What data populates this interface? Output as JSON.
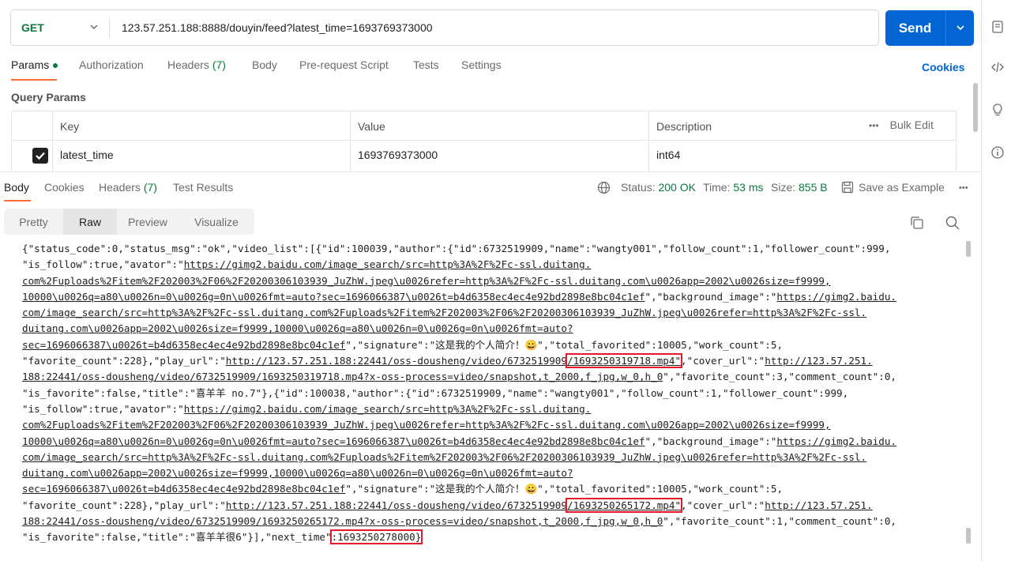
{
  "request": {
    "method": "GET",
    "url": "123.57.251.188:8888/douyin/feed?latest_time=1693769373000",
    "send_label": "Send"
  },
  "request_tabs": [
    {
      "label": "Params",
      "count": ""
    },
    {
      "label": "Authorization",
      "count": ""
    },
    {
      "label": "Headers",
      "count": "(7)"
    },
    {
      "label": "Body",
      "count": ""
    },
    {
      "label": "Pre-request Script",
      "count": ""
    },
    {
      "label": "Tests",
      "count": ""
    },
    {
      "label": "Settings",
      "count": ""
    }
  ],
  "cookies_link": "Cookies",
  "query_params": {
    "title": "Query Params",
    "headers": {
      "key": "Key",
      "value": "Value",
      "description": "Description",
      "bulk_edit": "Bulk Edit",
      "more": "•••"
    },
    "rows": [
      {
        "checked": true,
        "key": "latest_time",
        "value": "1693769373000",
        "description": "int64"
      }
    ]
  },
  "response_tabs": [
    {
      "label": "Body",
      "count": ""
    },
    {
      "label": "Cookies",
      "count": ""
    },
    {
      "label": "Headers",
      "count": "(7)"
    },
    {
      "label": "Test Results",
      "count": ""
    }
  ],
  "response_meta": {
    "status_label": "Status:",
    "status_value": "200 OK",
    "time_label": "Time:",
    "time_value": "53 ms",
    "size_label": "Size:",
    "size_value": "855 B",
    "save_example": "Save as Example",
    "more": "•••"
  },
  "view_modes": [
    "Pretty",
    "Raw",
    "Preview",
    "Visualize"
  ],
  "active_view": "Raw",
  "response_body_lines": [
    [
      {
        "t": "{\"status_code\":0,\"status_msg\":\"ok\",\"video_list\":[{\"id\":100039,\"author\":{\"id\":6732519909,\"name\":\"wangty001\",\"follow_count\":1,\"follower_count\":999,"
      }
    ],
    [
      {
        "t": "\"is_follow\":true,\"avator\":\""
      },
      {
        "t": "https://gimg2.baidu.com/image_search/src=http%3A%2F%2Fc-ssl.duitang.",
        "u": true
      }
    ],
    [
      {
        "t": "com%2Fuploads%2Fitem%2F202003%2F06%2F20200306103939_JuZhW.jpeg\\u0026refer=http%3A%2F%2Fc-ssl.duitang.com\\u0026app=2002\\u0026size=f9999,",
        "u": true
      }
    ],
    [
      {
        "t": "10000\\u0026q=a80\\u0026n=0\\u0026g=0n\\u0026fmt=auto?sec=1696066387\\u0026t=b4d6358ec4ec4e92bd2898e8bc04c1ef",
        "u": true
      },
      {
        "t": "\",\"background_image\":\""
      },
      {
        "t": "https://gimg2.baidu.",
        "u": true
      }
    ],
    [
      {
        "t": "com/image_search/src=http%3A%2F%2Fc-ssl.duitang.com%2Fuploads%2Fitem%2F202003%2F06%2F20200306103939_JuZhW.jpeg\\u0026refer=http%3A%2F%2Fc-ssl.",
        "u": true
      }
    ],
    [
      {
        "t": "duitang.com\\u0026app=2002\\u0026size=f9999,10000\\u0026q=a80\\u0026n=0\\u0026g=0n\\u0026fmt=auto?",
        "u": true
      }
    ],
    [
      {
        "t": "sec=1696066387\\u0026t=b4d6358ec4ec4e92bd2898e8bc04c1ef",
        "u": true
      },
      {
        "t": "\",\"signature\":\"这是我的个人简介！😀\",\"total_favorited\":10005,\"work_count\":5,"
      }
    ],
    [
      {
        "t": "\"favorite_count\":228},\"play_url\":\""
      },
      {
        "t": "http://123.57.251.188:22441/oss-dousheng/video/6732519909",
        "u": true
      },
      {
        "t": "/1693250319718.mp4\"",
        "u": true,
        "hl": true
      },
      {
        "t": ",\"cover_url\":\""
      },
      {
        "t": "http://123.57.251.",
        "u": true
      }
    ],
    [
      {
        "t": "188:22441/oss-dousheng/video/6732519909/1693250319718.mp4?x-oss-process=video/snapshot,t_2000,f_jpg,w_0,h_0",
        "u": true
      },
      {
        "t": "\",\"favorite_count\":3,\"comment_count\":0,"
      }
    ],
    [
      {
        "t": "\"is_favorite\":false,\"title\":\"喜羊羊 no.7\"},{\"id\":100038,\"author\":{\"id\":6732519909,\"name\":\"wangty001\",\"follow_count\":1,\"follower_count\":999,"
      }
    ],
    [
      {
        "t": "\"is_follow\":true,\"avator\":\""
      },
      {
        "t": "https://gimg2.baidu.com/image_search/src=http%3A%2F%2Fc-ssl.duitang.",
        "u": true
      }
    ],
    [
      {
        "t": "com%2Fuploads%2Fitem%2F202003%2F06%2F20200306103939_JuZhW.jpeg\\u0026refer=http%3A%2F%2Fc-ssl.duitang.com\\u0026app=2002\\u0026size=f9999,",
        "u": true
      }
    ],
    [
      {
        "t": "10000\\u0026q=a80\\u0026n=0\\u0026g=0n\\u0026fmt=auto?sec=1696066387\\u0026t=b4d6358ec4ec4e92bd2898e8bc04c1ef",
        "u": true
      },
      {
        "t": "\",\"background_image\":\""
      },
      {
        "t": "https://gimg2.baidu.",
        "u": true
      }
    ],
    [
      {
        "t": "com/image_search/src=http%3A%2F%2Fc-ssl.duitang.com%2Fuploads%2Fitem%2F202003%2F06%2F20200306103939_JuZhW.jpeg\\u0026refer=http%3A%2F%2Fc-ssl.",
        "u": true
      }
    ],
    [
      {
        "t": "duitang.com\\u0026app=2002\\u0026size=f9999,10000\\u0026q=a80\\u0026n=0\\u0026g=0n\\u0026fmt=auto?",
        "u": true
      }
    ],
    [
      {
        "t": "sec=1696066387\\u0026t=b4d6358ec4ec4e92bd2898e8bc04c1ef",
        "u": true
      },
      {
        "t": "\",\"signature\":\"这是我的个人简介！😀\",\"total_favorited\":10005,\"work_count\":5,"
      }
    ],
    [
      {
        "t": "\"favorite_count\":228},\"play_url\":\""
      },
      {
        "t": "http://123.57.251.188:22441/oss-dousheng/video/6732519909",
        "u": true
      },
      {
        "t": "/1693250265172.mp4\"",
        "u": true,
        "hl": true
      },
      {
        "t": ",\"cover_url\":\""
      },
      {
        "t": "http://123.57.251.",
        "u": true
      }
    ],
    [
      {
        "t": "188:22441/oss-dousheng/video/6732519909/1693250265172.mp4?x-oss-process=video/snapshot,t_2000,f_jpg,w_0,h_0",
        "u": true
      },
      {
        "t": "\",\"favorite_count\":1,\"comment_count\":0,"
      }
    ],
    [
      {
        "t": "\"is_favorite\":false,\"title\":\"喜羊羊很6\"}],\"next_time\""
      },
      {
        "t": ":1693250278000}",
        "hl": true
      }
    ]
  ]
}
